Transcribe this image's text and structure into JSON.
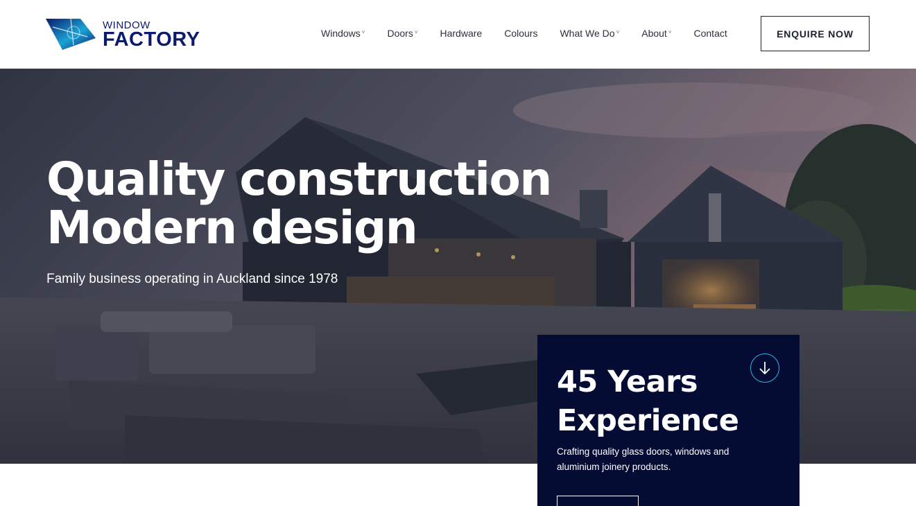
{
  "brand": {
    "top": "WINDOW",
    "bottom": "FACTORY",
    "color": "#0c1a6e",
    "accent": "#1aa3d4",
    "icon": "window-factory-logo-icon"
  },
  "nav": {
    "items": [
      {
        "label": "Windows",
        "has_dropdown": true
      },
      {
        "label": "Doors",
        "has_dropdown": true
      },
      {
        "label": "Hardware",
        "has_dropdown": false
      },
      {
        "label": "Colours",
        "has_dropdown": false
      },
      {
        "label": "What We Do",
        "has_dropdown": true
      },
      {
        "label": "About",
        "has_dropdown": true
      },
      {
        "label": "Contact",
        "has_dropdown": false
      }
    ],
    "chevron": "˅",
    "cta": "ENQUIRE NOW"
  },
  "hero": {
    "title_line1": "Quality construction",
    "title_line2": "Modern design",
    "subtitle": "Family business operating in Auckland since 1978"
  },
  "card": {
    "title_line1": "45 Years",
    "title_line2": "Experience",
    "description": "Crafting quality glass doors, windows and aluminium joinery products.",
    "arrow_icon": "arrow-down-icon",
    "background": "#050c33",
    "accent": "#2fb6e0"
  }
}
